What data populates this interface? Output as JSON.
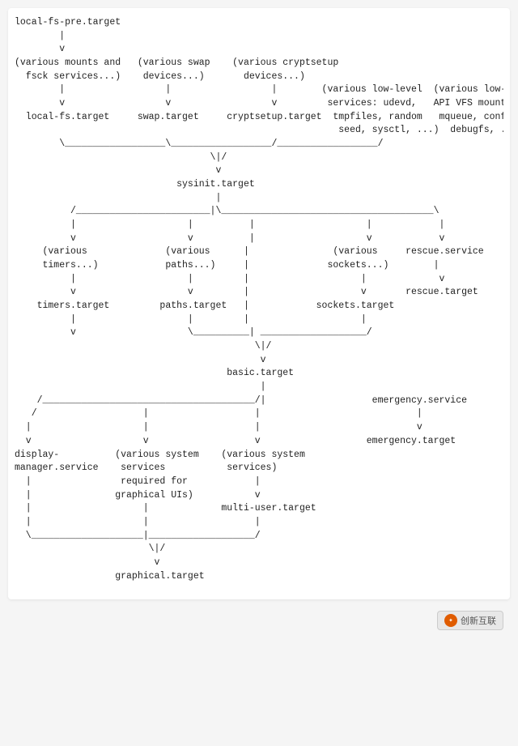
{
  "diagram": {
    "content": "local-fs-pre.target\n        |\n        v\n(various mounts and   (various swap    (various cryptsetup\n  fsck services...)    devices...)       devices...)\n        |                  |                  |        (various low-level  (various low-level\n        v                  v                  v         services: udevd,   API VFS mounts:\n  local-fs.target     swap.target     cryptsetup.target  tmpfiles, random   mqueue, configfs,\n                                                          seed, sysctl, ...)  debugfs, ...)\n        \\__________________\\__________________/__________________/\n                                   \\|/\n                                    v\n                             sysinit.target\n                                    |\n          /________________________|\\______________________________________\\\n          |                    |          |                    |            |\n          v                    v          |                    v            v\n     (various              (various      |               (various     rescue.service\n     timers...)            paths...)     |              sockets...)        |\n          |                    |         |                    |             v\n          v                    v         |                    v       rescue.target\n    timers.target         paths.target   |            sockets.target\n          |                    |         |                    |\n          v                    \\__________| ___________________/\n                                           \\|/\n                                            v\n                                      basic.target\n                                            |\n    /______________________________________/|                   emergency.service\n   /                   |                   |                            |\n  |                    |                   |                            v\n  v                    v                   v                   emergency.target\ndisplay-          (various system    (various system\nmanager.service    services           services)\n  |                required for            |\n  |               graphical UIs)           v\n  |                    |             multi-user.target\n  |                    |                   |\n  \\____________________|___________________/\n                        \\|/\n                         v\n                  graphical.target"
  },
  "footer": {
    "logo_text": "创新互联"
  }
}
